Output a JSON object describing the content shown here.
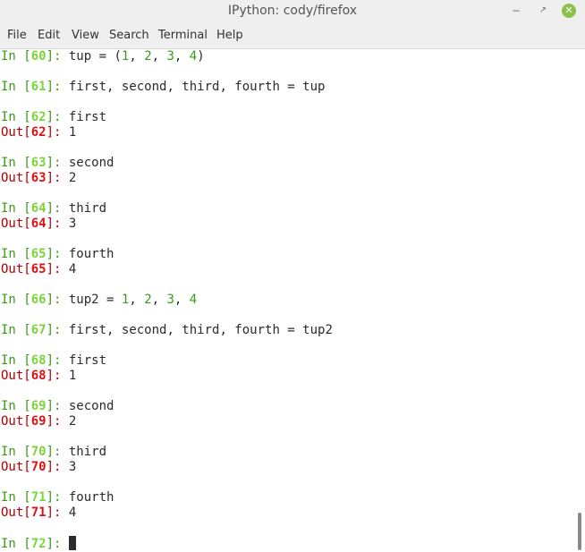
{
  "window": {
    "title": "IPython: cody/firefox",
    "min_glyph": "−",
    "max_glyph": "↗",
    "close_glyph": "✕",
    "close_color": "#8bc34a"
  },
  "menu": [
    "File",
    "Edit",
    "View",
    "Search",
    "Terminal",
    "Help"
  ],
  "colors": {
    "prompt_in": "#3a9a16",
    "prompt_in_number": "#7ad53a",
    "prompt_out": "#b00000",
    "prompt_out_number": "#e01010",
    "number_literal": "#3a9a16",
    "text": "#2b2b2b"
  },
  "terminal": {
    "lines": [
      {
        "type": "in",
        "n": "60",
        "code": [
          [
            "tup = (",
            "t"
          ],
          [
            "1",
            "n"
          ],
          [
            ", ",
            "t"
          ],
          [
            "2",
            "n"
          ],
          [
            ", ",
            "t"
          ],
          [
            "3",
            "n"
          ],
          [
            ", ",
            "t"
          ],
          [
            "4",
            "n"
          ],
          [
            ")",
            "t"
          ]
        ]
      },
      {
        "type": "blank"
      },
      {
        "type": "in",
        "n": "61",
        "code": [
          [
            "first, second, third, fourth = tup",
            "t"
          ]
        ]
      },
      {
        "type": "blank"
      },
      {
        "type": "in",
        "n": "62",
        "code": [
          [
            "first",
            "t"
          ]
        ]
      },
      {
        "type": "out",
        "n": "62",
        "text": "1"
      },
      {
        "type": "blank"
      },
      {
        "type": "in",
        "n": "63",
        "code": [
          [
            "second",
            "t"
          ]
        ]
      },
      {
        "type": "out",
        "n": "63",
        "text": "2"
      },
      {
        "type": "blank"
      },
      {
        "type": "in",
        "n": "64",
        "code": [
          [
            "third",
            "t"
          ]
        ]
      },
      {
        "type": "out",
        "n": "64",
        "text": "3"
      },
      {
        "type": "blank"
      },
      {
        "type": "in",
        "n": "65",
        "code": [
          [
            "fourth",
            "t"
          ]
        ]
      },
      {
        "type": "out",
        "n": "65",
        "text": "4"
      },
      {
        "type": "blank"
      },
      {
        "type": "in",
        "n": "66",
        "code": [
          [
            "tup2 = ",
            "t"
          ],
          [
            "1",
            "n"
          ],
          [
            ", ",
            "t"
          ],
          [
            "2",
            "n"
          ],
          [
            ", ",
            "t"
          ],
          [
            "3",
            "n"
          ],
          [
            ", ",
            "t"
          ],
          [
            "4",
            "n"
          ]
        ]
      },
      {
        "type": "blank"
      },
      {
        "type": "in",
        "n": "67",
        "code": [
          [
            "first, second, third, fourth = tup2",
            "t"
          ]
        ]
      },
      {
        "type": "blank"
      },
      {
        "type": "in",
        "n": "68",
        "code": [
          [
            "first",
            "t"
          ]
        ]
      },
      {
        "type": "out",
        "n": "68",
        "text": "1"
      },
      {
        "type": "blank"
      },
      {
        "type": "in",
        "n": "69",
        "code": [
          [
            "second",
            "t"
          ]
        ]
      },
      {
        "type": "out",
        "n": "69",
        "text": "2"
      },
      {
        "type": "blank"
      },
      {
        "type": "in",
        "n": "70",
        "code": [
          [
            "third",
            "t"
          ]
        ]
      },
      {
        "type": "out",
        "n": "70",
        "text": "3"
      },
      {
        "type": "blank"
      },
      {
        "type": "in",
        "n": "71",
        "code": [
          [
            "fourth",
            "t"
          ]
        ]
      },
      {
        "type": "out",
        "n": "71",
        "text": "4"
      },
      {
        "type": "blank"
      },
      {
        "type": "in",
        "n": "72",
        "code": [],
        "cursor": true
      }
    ]
  },
  "scrollbar": {
    "position": 0.97
  }
}
